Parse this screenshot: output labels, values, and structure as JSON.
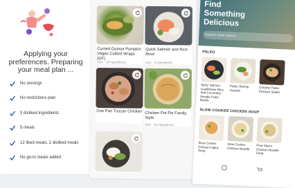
{
  "onboarding": {
    "heading": "Applying your preferences. Preparing your meal plan ...",
    "checks": [
      "No servings",
      "No restrictions plan",
      "3 disliked ingredients",
      "5 meals",
      "12 liked meals, 2 disliked meals",
      "No go-to meals added"
    ],
    "accent_color": "#2f4fbf"
  },
  "meal_plan": {
    "cards": [
      {
        "title": "Curried Quinoa Pumpkin Vegan Collard Wraps (GF)",
        "meta": "12m · 13 ingredients"
      },
      {
        "title": "Quick Salmon and Rice Bowl",
        "meta": "11m · 8 ingredients"
      },
      {
        "title": "One Pan Tuscan Chicken",
        "meta": ""
      },
      {
        "title": "Chicken Pot Pie Family Style",
        "meta": "40m · 13 ingredients"
      },
      {
        "title": "",
        "meta": ""
      }
    ]
  },
  "discover": {
    "hero_title": "Find Something Delicious",
    "search_placeholder": "Search meal names",
    "sections": [
      {
        "title": "PALEO",
        "items": [
          "Spicy Salmon Cauliflower Rice and Cucumber Noodle Poke Bowls",
          "Paleo Shrimp Scampi",
          "Creamy Paleo Chicken Skillet"
        ]
      },
      {
        "title": "SLOW COOKER CHICKEN SOUP",
        "items": [
          "Slow Cooker Chicken Fajita Soup",
          "Slow Cooker Chicken Noodle",
          "Poor Man's Chicken Noodle Soup"
        ]
      }
    ]
  }
}
